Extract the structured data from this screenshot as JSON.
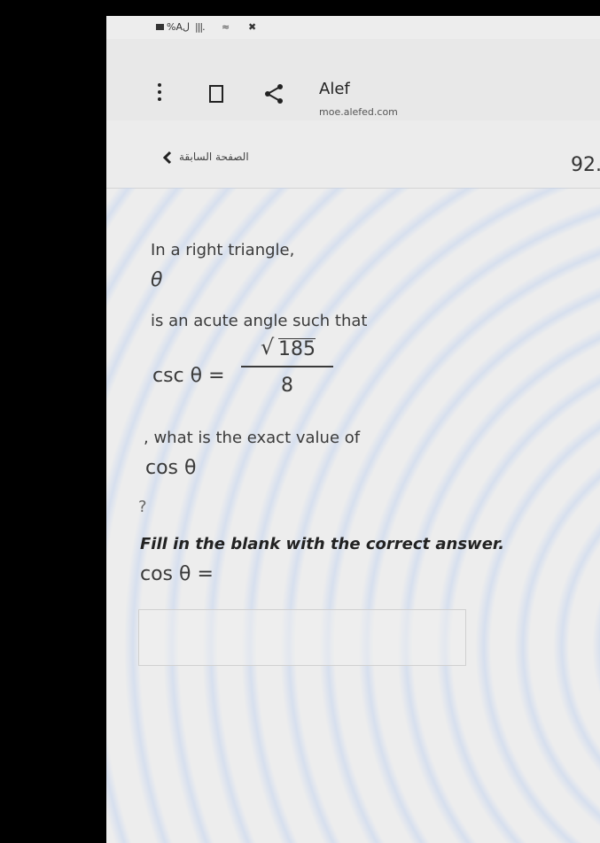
{
  "status_bar": {
    "battery_percent": "%Aل"
  },
  "browser": {
    "site_title": "Alef",
    "site_url": "moe.alefed.com"
  },
  "nav": {
    "previous_label": "الصفحة السابقة",
    "question_number": "92."
  },
  "question": {
    "line1": "In a right triangle,",
    "theta": "θ",
    "line2": "is an acute angle such that",
    "given_lhs": "csc θ =",
    "given_numerator": "185",
    "given_denominator": "8",
    "line3": ", what is the exact value of",
    "target": "cos θ",
    "line4": "?",
    "instruction": "Fill in the blank with the correct answer.",
    "answer_label": "cos θ =",
    "answer_value": ""
  }
}
